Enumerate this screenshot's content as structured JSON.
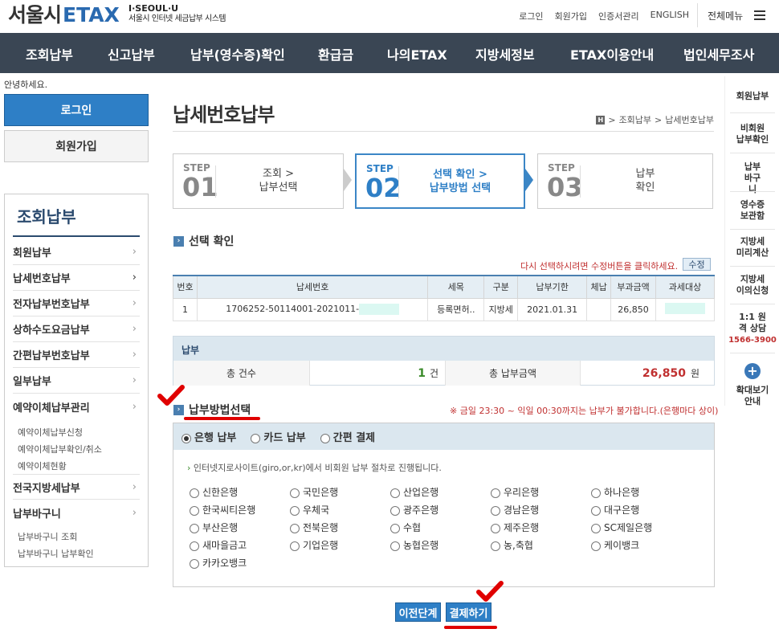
{
  "header": {
    "logo_main": "서울시",
    "logo_etax": "ETAX",
    "logo_sub1": "I·SEOUL·U",
    "logo_sub2": "서울시 인터넷 세금납부 시스템",
    "links": [
      "로그인",
      "회원가입",
      "인증서관리",
      "ENGLISH"
    ],
    "all_menu": "전체메뉴"
  },
  "nav": [
    "조회납부",
    "신고납부",
    "납부(영수증)확인",
    "환급금",
    "나의ETAX",
    "지방세정보",
    "ETAX이용안내",
    "법인세무조사"
  ],
  "sidebar": {
    "greeting": "안녕하세요.",
    "login": "로그인",
    "join": "회원가입",
    "menu_title": "조회납부",
    "items": [
      "회원납부",
      "납세번호납부",
      "전자납부번호납부",
      "상하수도요금납부",
      "간편납부번호납부",
      "일부납부",
      "예약이체납부관리",
      "전국지방세납부",
      "납부바구니"
    ],
    "sub_reserve": [
      "예약이체납부신청",
      "예약이체납부확인/취소",
      "예약이체현황"
    ],
    "sub_basket": [
      "납부바구니 조회",
      "납부바구니 납부확인"
    ]
  },
  "main": {
    "title": "납세번호납부",
    "home": "H",
    "crumb": [
      "조회납부",
      "납세번호납부"
    ],
    "steps": [
      {
        "label": "STEP",
        "num": "01",
        "line1": "조회 >",
        "line2": "납부선택"
      },
      {
        "label": "STEP",
        "num": "02",
        "line1": "선택 확인 >",
        "line2": "납부방법 선택"
      },
      {
        "label": "STEP",
        "num": "03",
        "line1": "납부",
        "line2": "확인"
      }
    ],
    "confirm_title": "선택 확인",
    "reselect_note": "다시 선택하시려면 수정버튼을 클릭하세요.",
    "edit_button": "수정",
    "table": {
      "headers": [
        "번호",
        "납세번호",
        "세목",
        "구분",
        "납부기한",
        "체납",
        "부과금액",
        "과세대상"
      ],
      "row": [
        "1",
        "1706252-50114001-2021011-",
        "등록면허..",
        "지방세",
        "2021.01.31",
        "",
        "26,850",
        ""
      ]
    },
    "summary": {
      "head": "납부",
      "count_label": "총 건수",
      "count_value": "1",
      "count_unit": "건",
      "amount_label": "총 납부금액",
      "amount_value": "26,850",
      "amount_unit": "원"
    },
    "pay_title": "납부방법선택",
    "pay_warning": "※ 금일 23:30 ~ 익일 00:30까지는 납부가 불가합니다.(은행마다 상이)",
    "pay_tabs": [
      "은행 납부",
      "카드 납부",
      "간편 결제"
    ],
    "pay_note": "인터넷지로사이트(giro,or,kr)에서 비회원 납부 절차로 진행됩니다.",
    "banks": [
      "신한은행",
      "국민은행",
      "산업은행",
      "우리은행",
      "하나은행",
      "한국씨티은행",
      "우체국",
      "광주은행",
      "경남은행",
      "대구은행",
      "부산은행",
      "전북은행",
      "수협",
      "제주은행",
      "SC제일은행",
      "새마을금고",
      "기업은행",
      "농협은행",
      "농,축협",
      "케이뱅크",
      "카카오뱅크"
    ],
    "prev_button": "이전단계",
    "pay_button": "결제하기"
  },
  "quick": {
    "items": [
      "회원납부",
      "비회원 납부확인",
      "납부 바구니",
      "영수증 보관함",
      "지방세 미리계산",
      "지방세 이의신청",
      "1:1 원격 상담"
    ],
    "phone": "1566-3900",
    "zoom_label": "확대보기 안내"
  },
  "colors": {
    "nav_bg": "#3a4654",
    "accent": "#2e7fc6",
    "annotation": "#e00000"
  }
}
